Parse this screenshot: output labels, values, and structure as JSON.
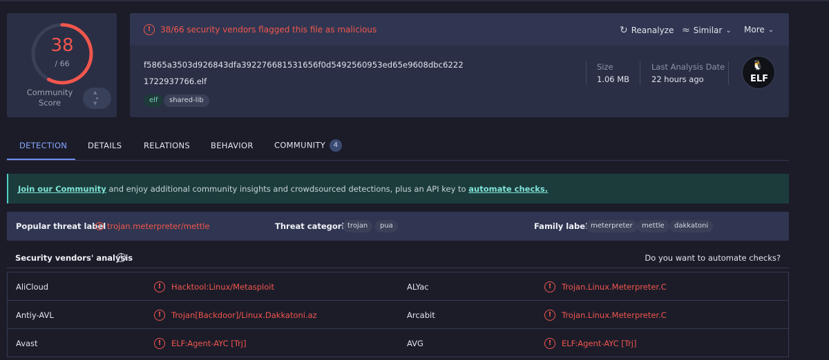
{
  "score": {
    "detections": "38",
    "total": "/ 66",
    "detection_fraction": 0.576,
    "community_label": "Community Score",
    "colors": {
      "malicious": "#f2564d",
      "track": "#3a4057"
    }
  },
  "header": {
    "alert": "38/66 security vendors flagged this file as malicious",
    "actions": {
      "reanalyze": "Reanalyze",
      "similar": "Similar",
      "more": "More"
    },
    "hash": "f5865a3503d926843dfa392276681531656f0d5492560953ed65e9608dbc6222",
    "filename": "1722937766.elf",
    "tags": [
      "elf",
      "shared-lib"
    ],
    "size_label": "Size",
    "size_value": "1.06 MB",
    "date_label": "Last Analysis Date",
    "date_value": "22 hours ago",
    "file_type_badge": "ELF"
  },
  "tabs": {
    "detection": "DETECTION",
    "details": "DETAILS",
    "relations": "RELATIONS",
    "behavior": "BEHAVIOR",
    "community": "COMMUNITY",
    "community_count": "4"
  },
  "banner": {
    "join_link": "Join our Community",
    "middle": " and enjoy additional community insights and crowdsourced detections, plus an API key to ",
    "automate_link": "automate checks."
  },
  "threat": {
    "popular_label": "Popular threat label",
    "popular_value": "trojan.meterpreter/mettle",
    "categories_label": "Threat categories",
    "categories": [
      "trojan",
      "pua"
    ],
    "family_label": "Family labels",
    "families": [
      "meterpreter",
      "mettle",
      "dakkatoni"
    ]
  },
  "vendors": {
    "title": "Security vendors' analysis",
    "automate_question": "Do you want to automate checks?",
    "rows": [
      {
        "left_name": "AliCloud",
        "left_result": "Hacktool:Linux/Metasploit",
        "right_name": "ALYac",
        "right_result": "Trojan.Linux.Meterpreter.C"
      },
      {
        "left_name": "Antiy-AVL",
        "left_result": "Trojan[Backdoor]/Linux.Dakkatoni.az",
        "right_name": "Arcabit",
        "right_result": "Trojan.Linux.Meterpreter.C"
      },
      {
        "left_name": "Avast",
        "left_result": "ELF:Agent-AYC [Trj]",
        "right_name": "AVG",
        "right_result": "ELF:Agent-AYC [Trj]"
      }
    ]
  }
}
